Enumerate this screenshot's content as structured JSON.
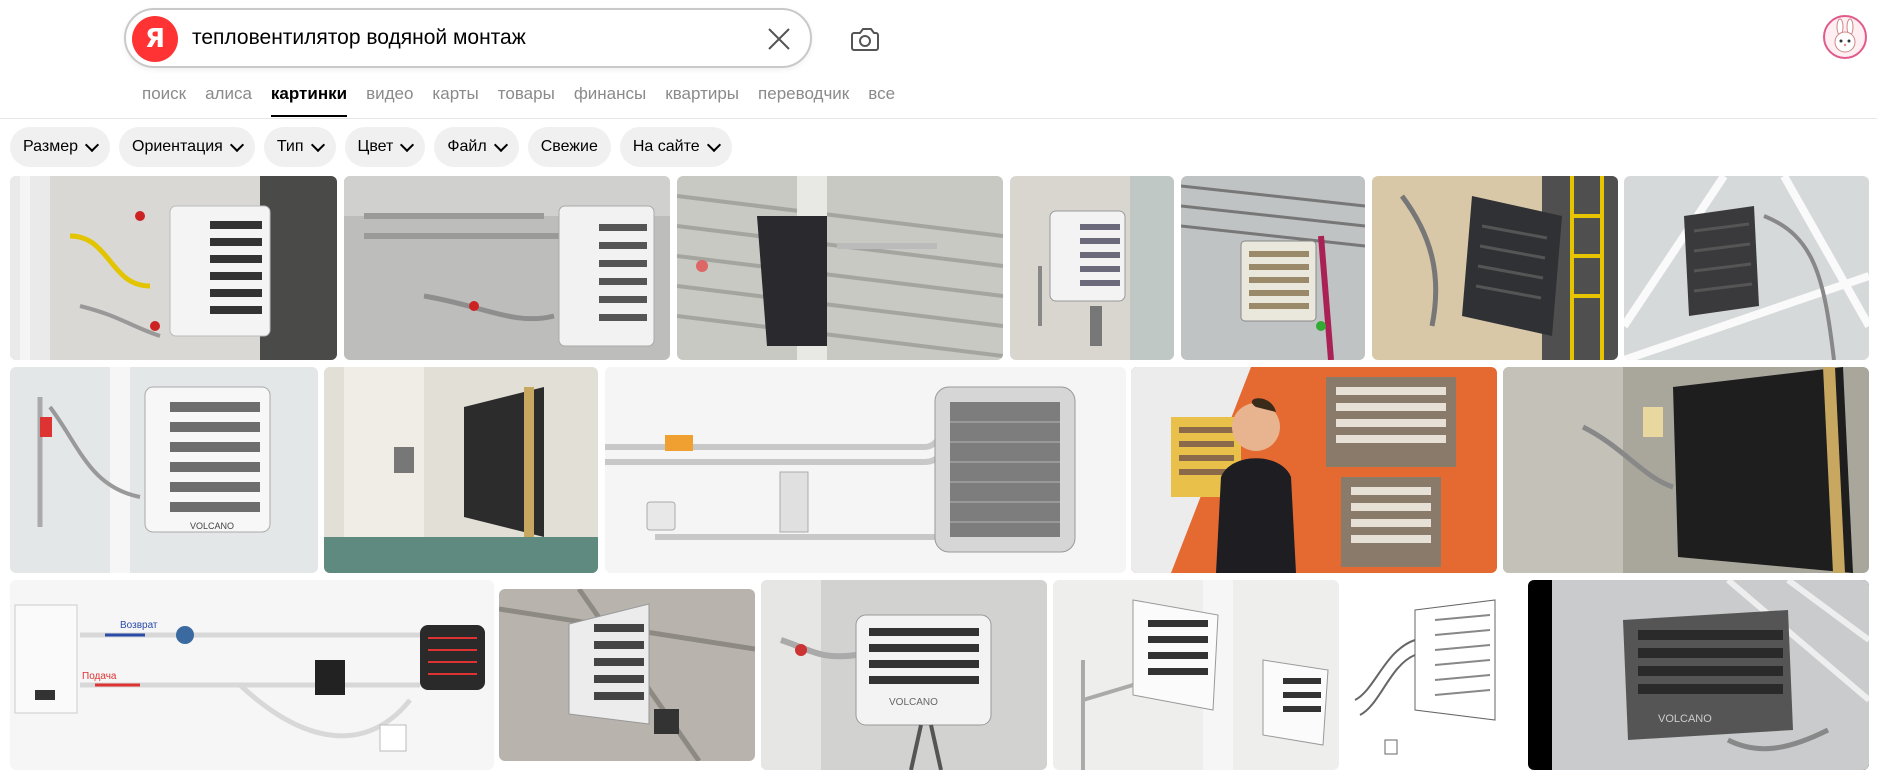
{
  "search": {
    "query": "тепловентилятор водяной монтаж",
    "logo_letter": "Я"
  },
  "tabs": [
    {
      "label": "поиск"
    },
    {
      "label": "алиса"
    },
    {
      "label": "картинки",
      "active": true
    },
    {
      "label": "видео"
    },
    {
      "label": "карты"
    },
    {
      "label": "товары"
    },
    {
      "label": "финансы"
    },
    {
      "label": "квартиры"
    },
    {
      "label": "переводчик"
    },
    {
      "label": "все"
    }
  ],
  "filters": [
    {
      "label": "Размер",
      "has_dropdown": true
    },
    {
      "label": "Ориентация",
      "has_dropdown": true
    },
    {
      "label": "Тип",
      "has_dropdown": true
    },
    {
      "label": "Цвет",
      "has_dropdown": true
    },
    {
      "label": "Файл",
      "has_dropdown": true
    },
    {
      "label": "Свежие",
      "has_dropdown": false
    },
    {
      "label": "На сайте",
      "has_dropdown": true
    }
  ],
  "icons": {
    "clear": "close-icon",
    "camera": "camera-search-icon",
    "avatar": "user-avatar"
  },
  "colors": {
    "brand_red": "#ff3333",
    "active_tab": "#000000",
    "inactive_tab": "#8a8a8a",
    "chip_bg": "#f0f0f0"
  },
  "diagram_text": {
    "return": "Возврат",
    "supply": "Подача"
  },
  "brand_text": "VOLCANO"
}
